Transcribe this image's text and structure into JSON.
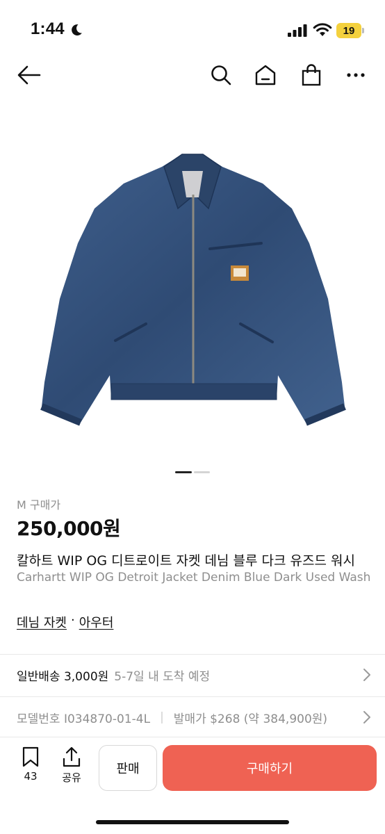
{
  "status": {
    "time": "1:44",
    "battery": "19"
  },
  "product": {
    "size": "M",
    "price_label": "구매가",
    "price": "250,000원",
    "title_ko": "칼하트 WIP OG 디트로이트 자켓 데님 블루 다크 유즈드 워시",
    "title_en": "Carhartt WIP OG Detroit Jacket Denim Blue Dark Used Wash",
    "image_count": 2,
    "image_index": 1
  },
  "category": {
    "items": [
      "데님 자켓",
      "아우터"
    ],
    "separator": "·"
  },
  "shipping": {
    "label": "일반배송 3,000원",
    "eta": "5-7일 내 도착 예정"
  },
  "model": {
    "label": "모델번호 I034870-01-4L",
    "release": "발매가 $268 (약 384,900원)"
  },
  "bottom": {
    "bookmark_count": "43",
    "share_label": "공유",
    "sell_label": "판매",
    "buy_label": "구매하기"
  },
  "colors": {
    "buy": "#ef6253",
    "battery": "#f4d13d"
  }
}
